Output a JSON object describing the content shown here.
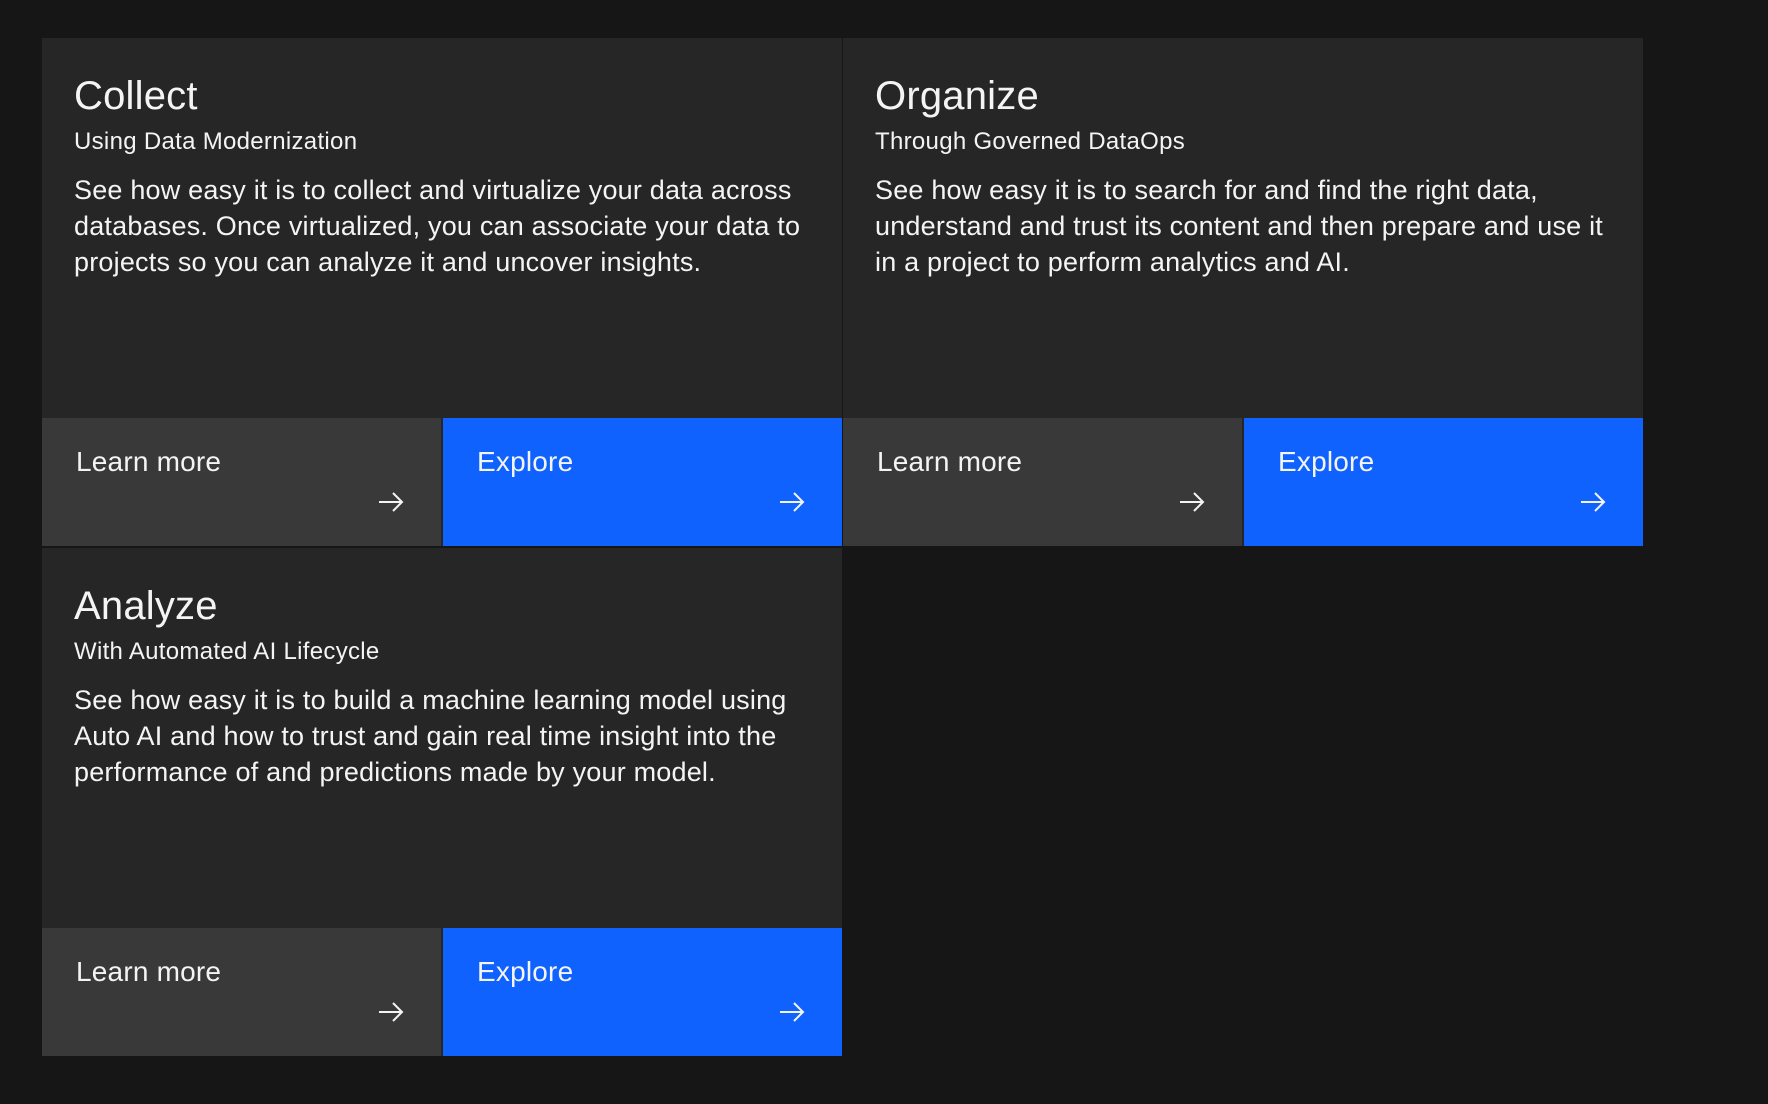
{
  "tiles": [
    {
      "title": "Collect",
      "subtitle": "Using Data Modernization",
      "description": "See how easy it is to collect and virtualize your data across databases. Once virtualized, you can associate your data to projects so you can analyze it and uncover insights.",
      "learn_label": "Learn more",
      "explore_label": "Explore"
    },
    {
      "title": "Organize",
      "subtitle": "Through Governed DataOps",
      "description": "See how easy it is to search for and find the right data, understand and trust its content and then prepare and use it in a project to perform analytics and AI.",
      "learn_label": "Learn more",
      "explore_label": "Explore"
    },
    {
      "title": "Analyze",
      "subtitle": "With Automated AI Lifecycle",
      "description": "See how easy it is to build a machine learning model using Auto AI and how to trust and gain real time insight into the performance of and predictions made by your model.",
      "learn_label": "Learn more",
      "explore_label": "Explore"
    }
  ],
  "colors": {
    "background": "#161616",
    "tile": "#262626",
    "learn_button": "#393939",
    "explore_button": "#0f62fe",
    "text": "#f4f4f4"
  },
  "icons": {
    "action_arrow": "arrow-right-icon"
  }
}
